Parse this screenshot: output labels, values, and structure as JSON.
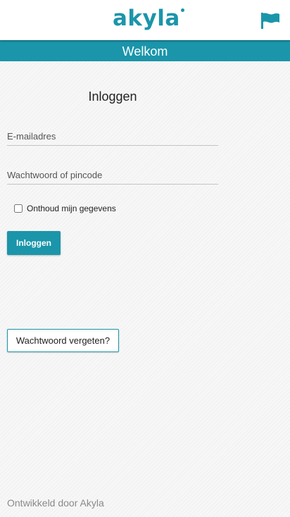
{
  "header": {
    "logo_text": "akyla",
    "flag_icon": "flag-icon",
    "brand_color": "#1b95aa"
  },
  "banner": {
    "title": "Welkom"
  },
  "login": {
    "title": "Inloggen",
    "email_placeholder": "E-mailadres",
    "email_value": "",
    "password_placeholder": "Wachtwoord of pincode",
    "password_value": "",
    "remember_label": "Onthoud mijn gegevens",
    "remember_checked": false,
    "submit_label": "Inloggen",
    "forgot_label": "Wachtwoord vergeten?"
  },
  "footer": {
    "text": "Ontwikkeld door Akyla"
  }
}
